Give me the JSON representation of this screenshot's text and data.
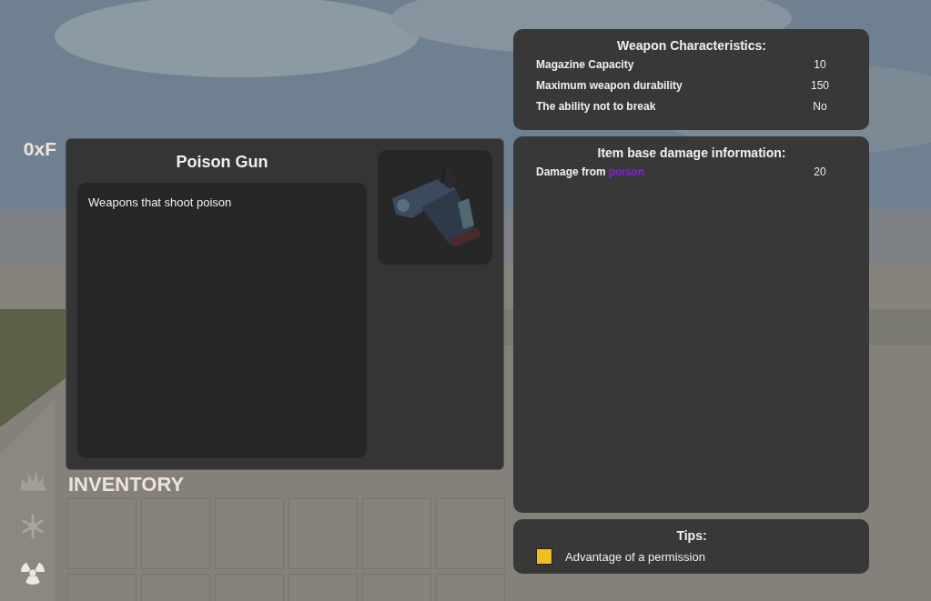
{
  "hud": {
    "counter": "0xF"
  },
  "item": {
    "name": "Poison Gun",
    "description": "Weapons that shoot poison"
  },
  "inventory": {
    "title": "INVENTORY"
  },
  "characteristics": {
    "title": "Weapon Characteristics:",
    "rows": [
      {
        "label": "Magazine Capacity",
        "value": "10"
      },
      {
        "label": "Maximum weapon durability",
        "value": "150"
      },
      {
        "label": "The ability not to break",
        "value": "No"
      }
    ]
  },
  "damage": {
    "title": "Item base damage information:",
    "rows": [
      {
        "label": "Damage from",
        "type": "poison",
        "color": "#8a1fd8",
        "value": "20"
      }
    ]
  },
  "tips": {
    "title": "Tips:",
    "items": [
      {
        "color": "#f0c020",
        "text": "Advantage of a permission"
      }
    ]
  }
}
